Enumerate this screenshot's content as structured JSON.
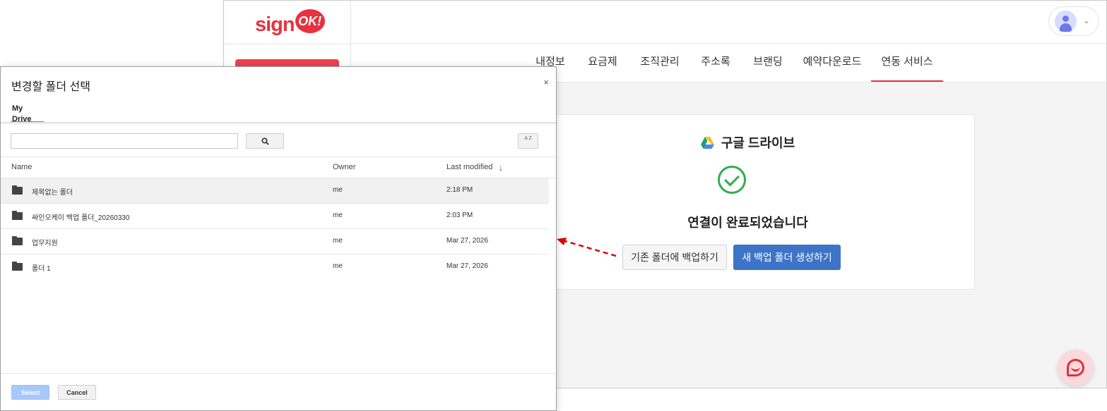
{
  "app": {
    "logo": {
      "sign_text": "sign",
      "ok_text": "OK!"
    },
    "nav_tabs": [
      {
        "label": "내정보"
      },
      {
        "label": "요금제"
      },
      {
        "label": "조직관리"
      },
      {
        "label": "주소록"
      },
      {
        "label": "브랜딩"
      },
      {
        "label": "예약다운로드"
      },
      {
        "label": "연동 서비스",
        "active": true
      }
    ],
    "card": {
      "title": "구글 드라이브",
      "icon": "google-drive-icon",
      "status_icon": "check-circle-icon",
      "message": "연결이 완료되었습니다",
      "btn_existing": "기존 폴더에 백업하기",
      "btn_new": "새 백업 폴더 생성하기"
    },
    "colors": {
      "brand": "#e8323f",
      "primary": "#3d74c8",
      "success": "#2fae4c",
      "highlight": "#e00000"
    }
  },
  "picker": {
    "title": "변경할 폴더 선택",
    "close": "×",
    "tab": "My Drive",
    "search_placeholder": "",
    "sort_icon_text": "A Z",
    "columns": {
      "name": "Name",
      "owner": "Owner",
      "modified": "Last modified",
      "sort_arrow": "↓"
    },
    "rows": [
      {
        "name": "제목없는 폴더",
        "owner": "me",
        "modified": "2:18 PM",
        "selected": true
      },
      {
        "name": "싸인오케이 백업 폴더_20260330",
        "owner": "me",
        "modified": "2:03 PM"
      },
      {
        "name": "업무지원",
        "owner": "me",
        "modified": "Mar 27, 2026"
      },
      {
        "name": "폴더 1",
        "owner": "me",
        "modified": "Mar 27, 2026"
      }
    ],
    "select_label": "Select",
    "cancel_label": "Cancel"
  }
}
